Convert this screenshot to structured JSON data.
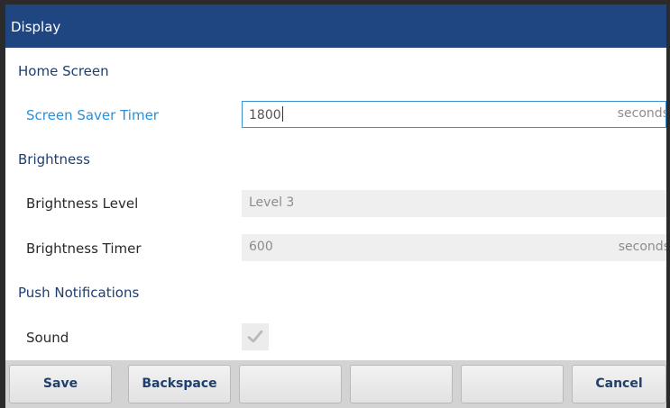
{
  "title": "Display",
  "sections": {
    "home_screen": "Home Screen",
    "brightness": "Brightness",
    "push_notifications": "Push Notifications"
  },
  "rows": {
    "screen_saver_timer": {
      "label": "Screen Saver Timer",
      "value": "1800",
      "unit": "seconds"
    },
    "brightness_level": {
      "label": "Brightness Level",
      "value": "Level 3"
    },
    "brightness_timer": {
      "label": "Brightness Timer",
      "value": "600",
      "unit": "seconds"
    },
    "sound": {
      "label": "Sound",
      "checked": true
    }
  },
  "softkeys": [
    "Save",
    "Backspace",
    "",
    "",
    "",
    "Cancel"
  ],
  "colors": {
    "title_bar": "#1f4680",
    "active_label": "#2e8fd6",
    "section_text": "#1f3f6e"
  }
}
